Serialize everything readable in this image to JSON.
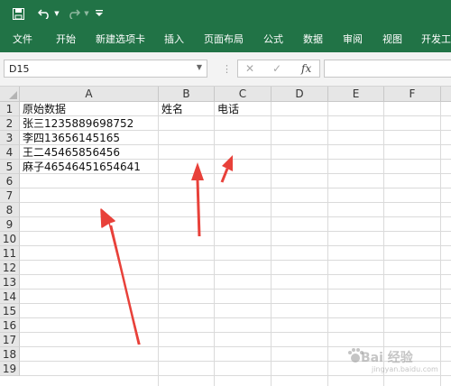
{
  "ribbon": {
    "accent": "#217346",
    "tabs": [
      "文件",
      "开始",
      "新建选项卡",
      "插入",
      "页面布局",
      "公式",
      "数据",
      "审阅",
      "视图",
      "开发工"
    ]
  },
  "quick_access": {
    "icons": [
      "save-icon",
      "undo-icon",
      "redo-icon",
      "customize-icon"
    ]
  },
  "formula_bar": {
    "name_box": "D15",
    "fx": "fx",
    "formula": ""
  },
  "sheet": {
    "columns": [
      "A",
      "B",
      "C",
      "D",
      "E",
      "F"
    ],
    "rows": [
      "1",
      "2",
      "3",
      "4",
      "5",
      "6",
      "7",
      "8",
      "9",
      "10",
      "11",
      "12",
      "13",
      "14",
      "15",
      "16",
      "17",
      "18",
      "19"
    ],
    "cells": {
      "A1": "原始数据",
      "B1": "姓名",
      "C1": "电话",
      "A2": "张三1235889698752",
      "A3": "李四13656145165",
      "A4": "王二45465856456",
      "A5": "麻子46546451654641"
    }
  },
  "annotations": {
    "arrow_color": "#e8413a",
    "arrow_count": 3
  },
  "watermark": {
    "text": "Bai 经验",
    "sub": "jingyan.baidu.com"
  }
}
